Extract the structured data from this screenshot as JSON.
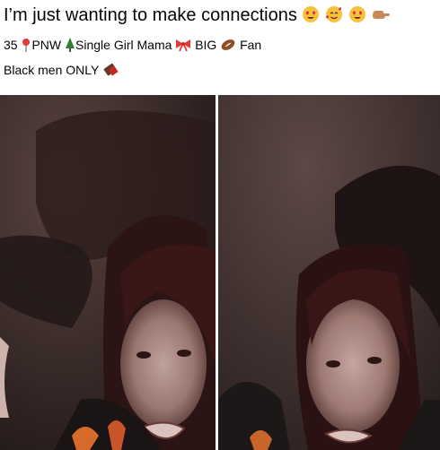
{
  "post": {
    "title": "I’m just wanting to make connections",
    "title_emoji_names": [
      "heart-eyes-emoji",
      "smiling-face-with-hearts-emoji",
      "heart-eyes-emoji",
      "pointing-hand-emoji"
    ],
    "line1": {
      "age": "35",
      "location": "PNW",
      "status": "Single Girl Mama",
      "interest_prefix": "BIG",
      "interest_suffix": "Fan",
      "emoji_names": [
        "pin-emoji",
        "tree-emoji",
        "bow-emoji",
        "football-emoji"
      ]
    },
    "line2": {
      "text": "Black men ONLY",
      "emoji_name": "chocolate-emoji"
    }
  },
  "gallery": {
    "photo_count": 2,
    "photo_names": [
      "photo-left",
      "photo-right"
    ]
  }
}
